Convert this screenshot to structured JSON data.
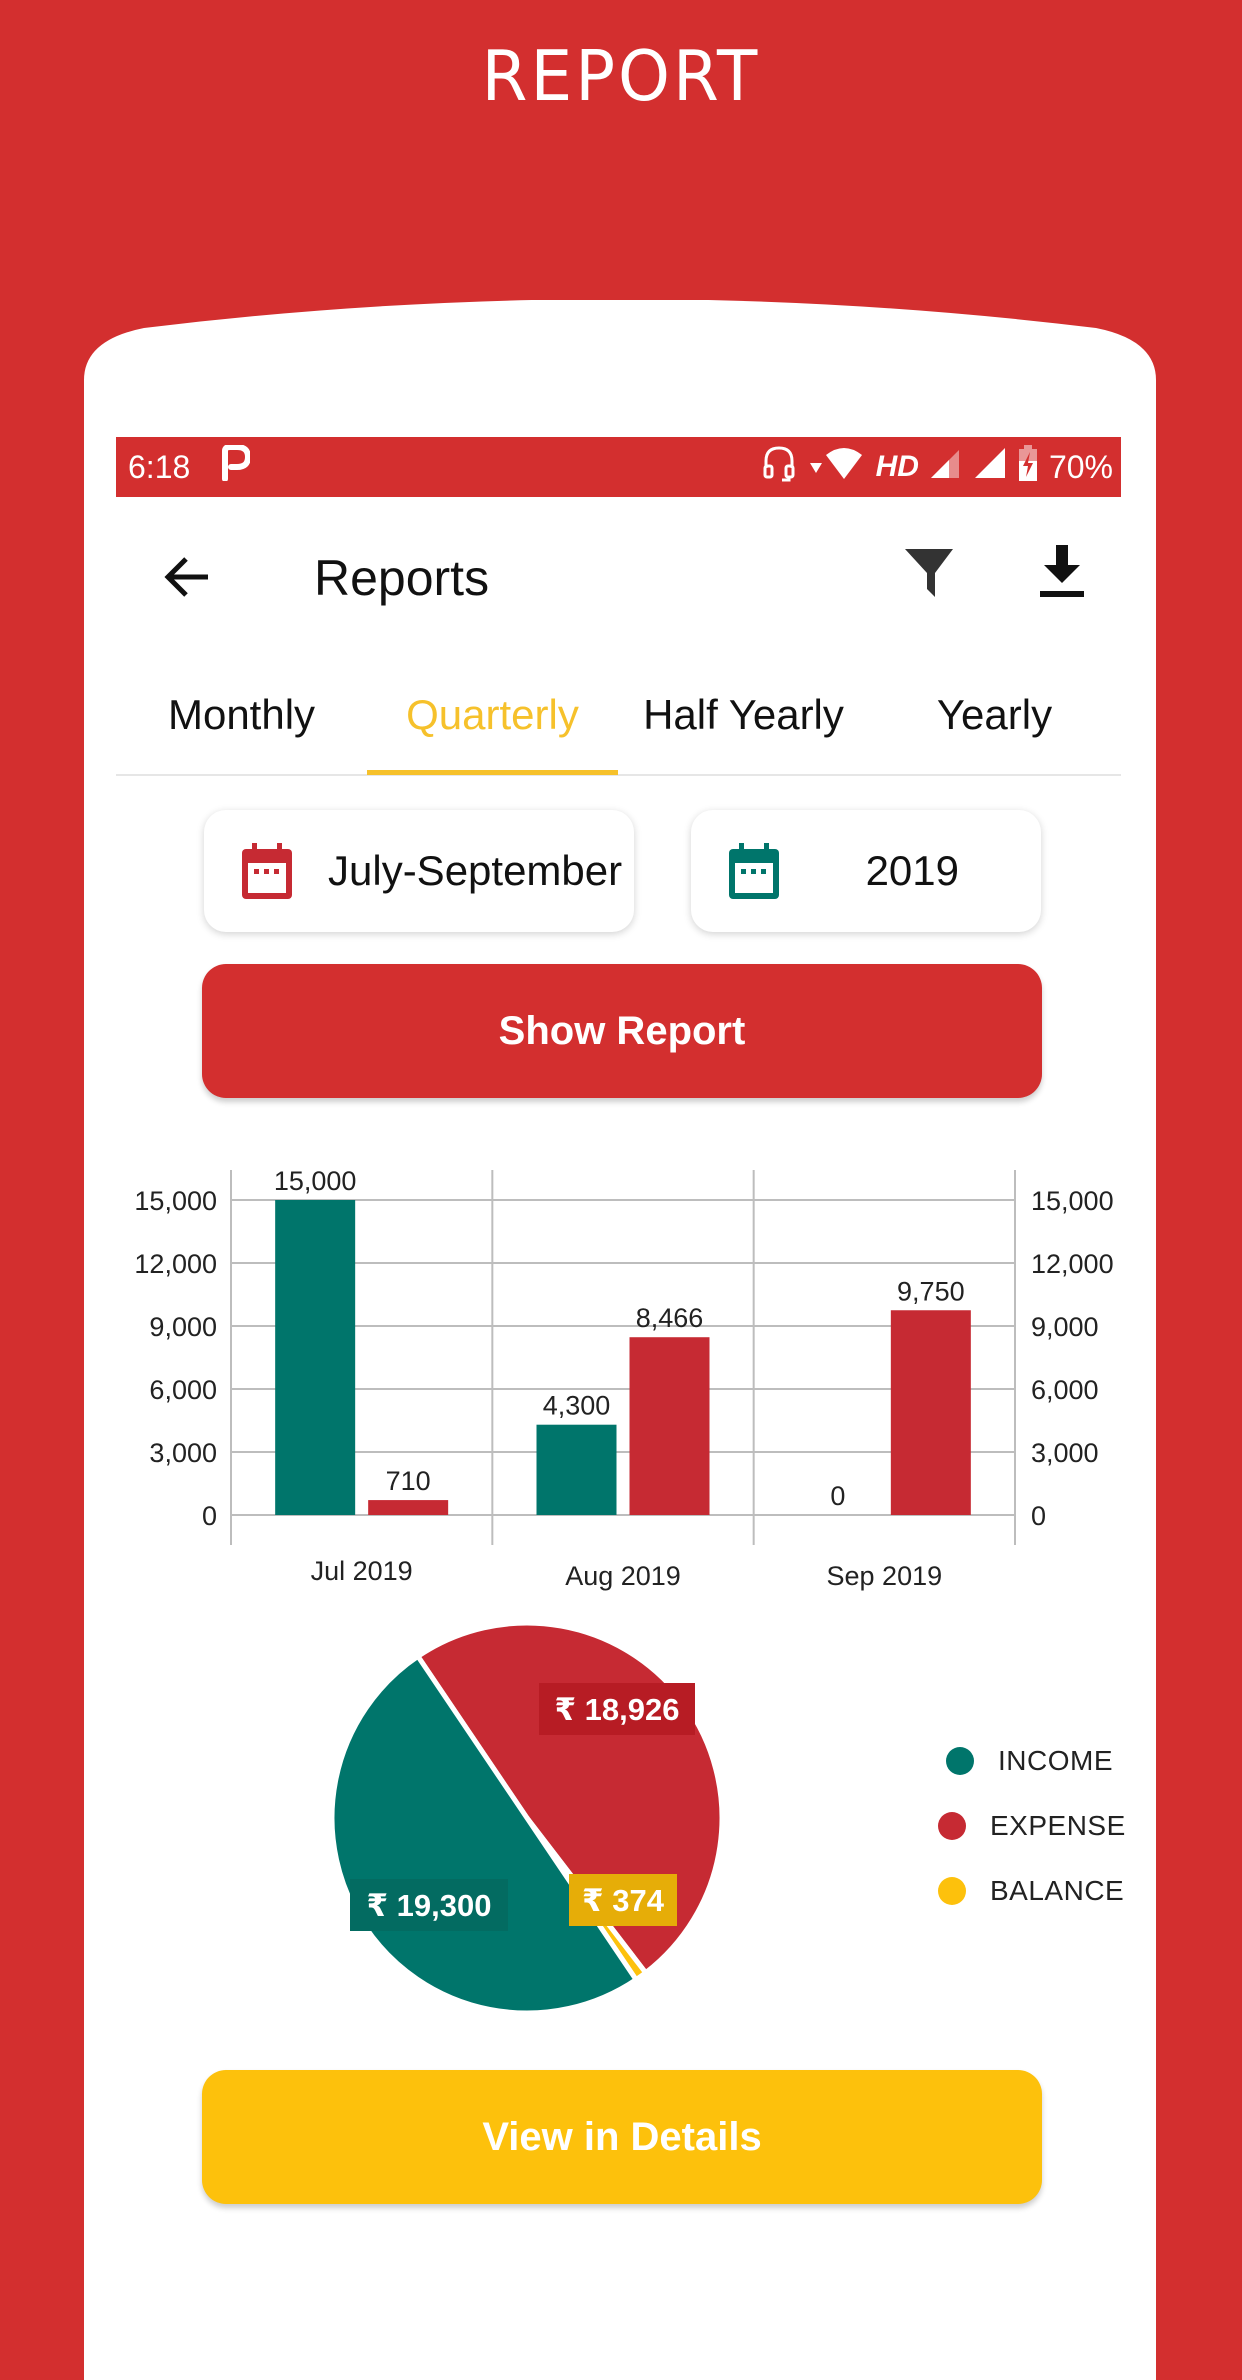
{
  "promo": {
    "title": "REPORT"
  },
  "status_bar": {
    "time": "6:18",
    "app_icon": "p-app-icon",
    "icons": [
      "headset-icon",
      "wifi-icon",
      "hd-icon",
      "signal-icon",
      "signal-icon",
      "battery-charging-icon"
    ],
    "network_label": "HD",
    "battery": "70%"
  },
  "app_bar": {
    "title": "Reports",
    "back_icon": "arrow-left-icon",
    "filter_icon": "filter-icon",
    "download_icon": "download-icon"
  },
  "tabs": [
    {
      "label": "Monthly",
      "active": false
    },
    {
      "label": "Quarterly",
      "active": true
    },
    {
      "label": "Half Yearly",
      "active": false
    },
    {
      "label": "Yearly",
      "active": false
    }
  ],
  "filters": {
    "quarter": {
      "value": "July-September",
      "icon": "calendar-icon"
    },
    "year": {
      "value": "2019",
      "icon": "calendar-icon"
    }
  },
  "buttons": {
    "show_report": "Show Report",
    "view_details": "View in Details"
  },
  "colors": {
    "brand_red": "#d32f2f",
    "income": "#00756b",
    "expense": "#c62a33",
    "balance": "#fdc10c",
    "active_tab": "#f6c12b"
  },
  "legend": [
    {
      "label": "INCOME",
      "color": "#00756b"
    },
    {
      "label": "EXPENSE",
      "color": "#c62a33"
    },
    {
      "label": "BALANCE",
      "color": "#fdc10c"
    }
  ],
  "chart_data": [
    {
      "type": "bar",
      "title": "",
      "xlabel": "",
      "ylabel": "",
      "categories": [
        "Jul 2019",
        "Aug 2019",
        "Sep 2019"
      ],
      "series": [
        {
          "name": "Income",
          "color": "#00756b",
          "values": [
            15000,
            4300,
            0
          ],
          "labels": [
            "15,000",
            "4,300",
            "0"
          ]
        },
        {
          "name": "Expense",
          "color": "#c62a33",
          "values": [
            710,
            8466,
            9750
          ],
          "labels": [
            "710",
            "8,466",
            "9,750"
          ]
        }
      ],
      "ylim": [
        0,
        15000
      ],
      "yticks": [
        0,
        3000,
        6000,
        9000,
        12000,
        15000
      ],
      "ytick_labels": [
        "0",
        "3,000",
        "6,000",
        "9,000",
        "12,000",
        "15,000"
      ],
      "dual_y_axis": true,
      "grid": true
    },
    {
      "type": "pie",
      "slices": [
        {
          "name": "INCOME",
          "value": 19300,
          "label": "₹ 19,300",
          "color": "#00756b"
        },
        {
          "name": "EXPENSE",
          "value": 18926,
          "label": "₹ 18,926",
          "color": "#c62a33"
        },
        {
          "name": "BALANCE",
          "value": 374,
          "label": "₹ 374",
          "color": "#fdc10c"
        }
      ],
      "legend_position": "right"
    }
  ]
}
